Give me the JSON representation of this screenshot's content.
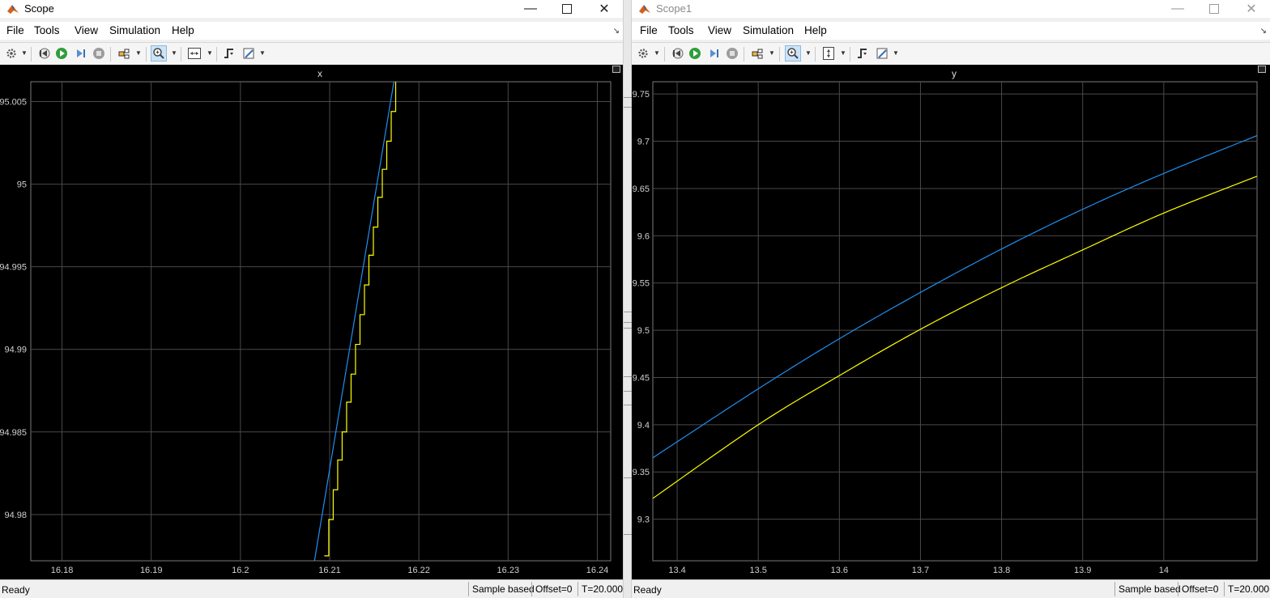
{
  "windows": [
    {
      "title": "Scope",
      "active": true,
      "menus": [
        "File",
        "Tools",
        "View",
        "Simulation",
        "Help"
      ],
      "status": {
        "ready": "Ready",
        "mode": "Sample based",
        "offset": "Offset=0",
        "time": "T=20.000"
      },
      "chart_data": {
        "type": "line",
        "title": "x",
        "xlabel": "",
        "ylabel": "",
        "xlim": [
          16.1765,
          16.2415
        ],
        "ylim": [
          94.9772,
          95.0062
        ],
        "xticks": [
          16.18,
          16.19,
          16.2,
          16.21,
          16.22,
          16.23,
          16.24
        ],
        "xtick_labels": [
          "16.18",
          "16.19",
          "16.2",
          "16.21",
          "16.22",
          "16.23",
          "16.24"
        ],
        "yticks": [
          94.98,
          94.985,
          94.99,
          94.995,
          95.0,
          95.005
        ],
        "ytick_labels": [
          "94.98",
          "94.985",
          "94.99",
          "94.995",
          "95",
          "95.005"
        ],
        "grid": true,
        "background": "#000000",
        "series": [
          {
            "color": "#1f8ff0",
            "style": "line",
            "x": [
              16.2083,
              16.2172
            ],
            "y": [
              94.9772,
              95.0062
            ]
          },
          {
            "color": "#ffff00",
            "style": "step",
            "x": [
              16.2094,
              16.2099,
              16.2104,
              16.2109,
              16.2114,
              16.2119,
              16.2124,
              16.2129,
              16.2134,
              16.2139,
              16.2144,
              16.2149,
              16.2154,
              16.2159,
              16.2164,
              16.2169,
              16.2174
            ],
            "y": [
              94.9775,
              94.9797,
              94.9815,
              94.9833,
              94.985,
              94.9868,
              94.9885,
              94.9903,
              94.9921,
              94.9939,
              94.9957,
              94.9974,
              94.9992,
              95.0009,
              95.0026,
              95.0044,
              95.0062
            ]
          }
        ]
      }
    },
    {
      "title": "Scope1",
      "active": false,
      "menus": [
        "File",
        "Tools",
        "View",
        "Simulation",
        "Help"
      ],
      "status": {
        "ready": "Ready",
        "mode": "Sample based",
        "offset": "Offset=0",
        "time": "T=20.000"
      },
      "chart_data": {
        "type": "line",
        "title": "y",
        "xlabel": "",
        "ylabel": "",
        "xlim": [
          13.37,
          14.115
        ],
        "ylim": [
          9.256,
          9.763
        ],
        "xticks": [
          13.4,
          13.5,
          13.6,
          13.7,
          13.8,
          13.9,
          14.0
        ],
        "xtick_labels": [
          "13.4",
          "13.5",
          "13.6",
          "13.7",
          "13.8",
          "13.9",
          "14"
        ],
        "yticks": [
          9.3,
          9.35,
          9.4,
          9.45,
          9.5,
          9.55,
          9.6,
          9.65,
          9.7,
          9.75
        ],
        "ytick_labels": [
          "9.3",
          "9.35",
          "9.4",
          "9.45",
          "9.5",
          "9.55",
          "9.6",
          "9.65",
          "9.7",
          "9.75"
        ],
        "grid": true,
        "background": "#000000",
        "series": [
          {
            "color": "#1f8ff0",
            "style": "line",
            "x": [
              13.37,
              13.5,
              13.6,
              13.7,
              13.8,
              13.9,
              14.0,
              14.115
            ],
            "y": [
              9.365,
              9.438,
              9.491,
              9.54,
              9.586,
              9.628,
              9.666,
              9.706
            ]
          },
          {
            "color": "#ffff00",
            "style": "line",
            "x": [
              13.37,
              13.5,
              13.6,
              13.7,
              13.8,
              13.9,
              14.0,
              14.115
            ],
            "y": [
              9.322,
              9.4,
              9.452,
              9.501,
              9.545,
              9.585,
              9.624,
              9.663
            ]
          }
        ]
      }
    }
  ]
}
